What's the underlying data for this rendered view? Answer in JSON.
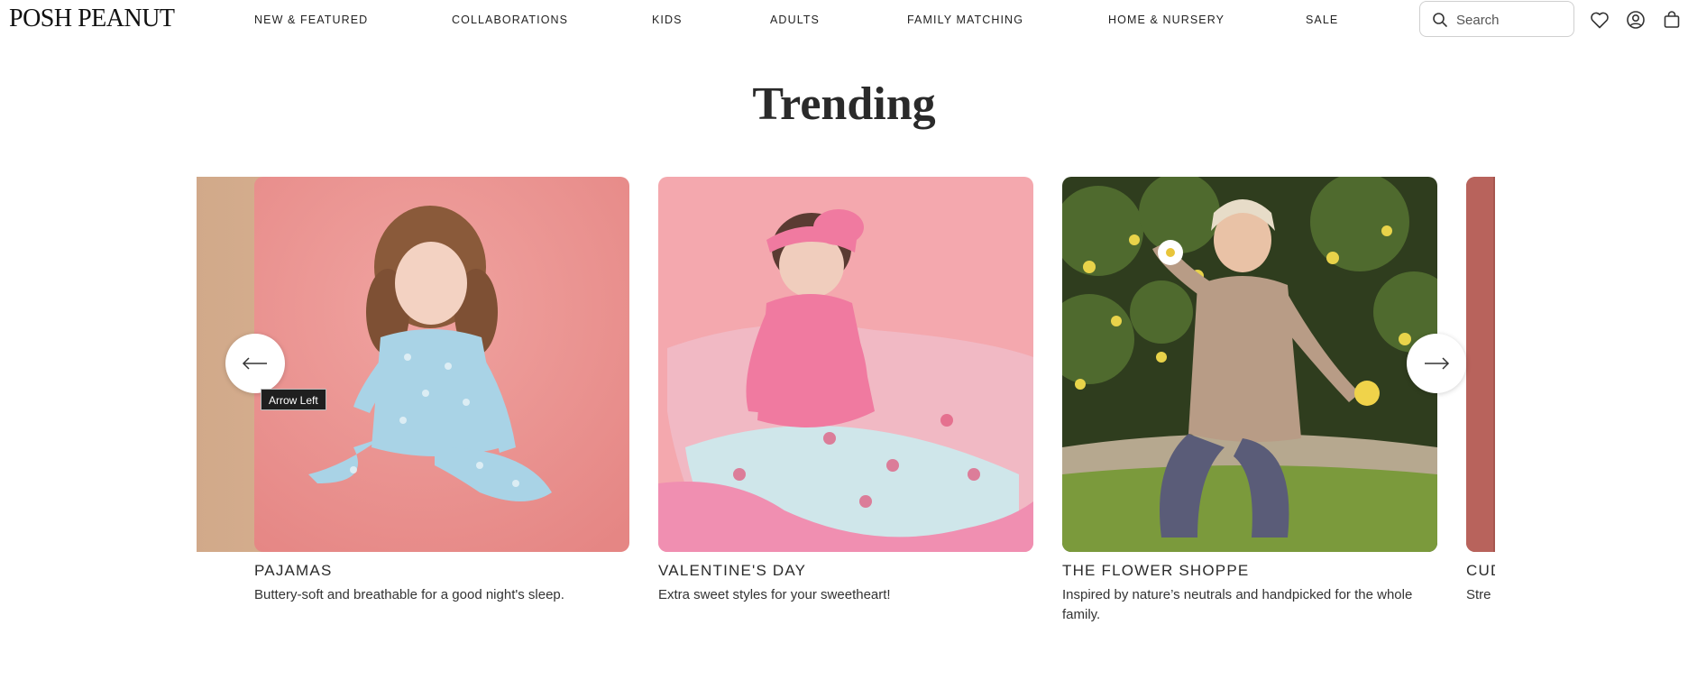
{
  "header": {
    "logo": "POSH PEANUT",
    "nav": [
      {
        "label": "NEW & FEATURED"
      },
      {
        "label": "COLLABORATIONS"
      },
      {
        "label": "KIDS"
      },
      {
        "label": "ADULTS"
      },
      {
        "label": "FAMILY MATCHING"
      },
      {
        "label": "HOME & NURSERY"
      },
      {
        "label": "SALE"
      }
    ],
    "search": {
      "placeholder": "Search",
      "value": ""
    },
    "icons": [
      "heart-icon",
      "account-icon",
      "cart-icon"
    ]
  },
  "section": {
    "title": "Trending"
  },
  "carousel": {
    "cards": [
      {
        "title": "PAJAMAS",
        "desc": "Buttery-soft and breathable for a good night's sleep."
      },
      {
        "title": "VALENTINE'S DAY",
        "desc": "Extra sweet styles for your sweetheart!"
      },
      {
        "title": "THE FLOWER SHOPPE",
        "desc": "Inspired by nature’s neutrals and handpicked for the whole family."
      },
      {
        "title": "CUD",
        "desc": "Stre"
      }
    ],
    "prev_tooltip": "Arrow Left",
    "prev_icon": "arrow-left-icon",
    "next_icon": "arrow-right-icon"
  },
  "colors": {
    "text": "#2b2b2b",
    "background": "#ffffff",
    "card_pink": "#eb9a9a",
    "card_light_pink": "#f2a4ad",
    "card_green": "#4f6a2e",
    "tooltip_bg": "#1f1f1f"
  }
}
